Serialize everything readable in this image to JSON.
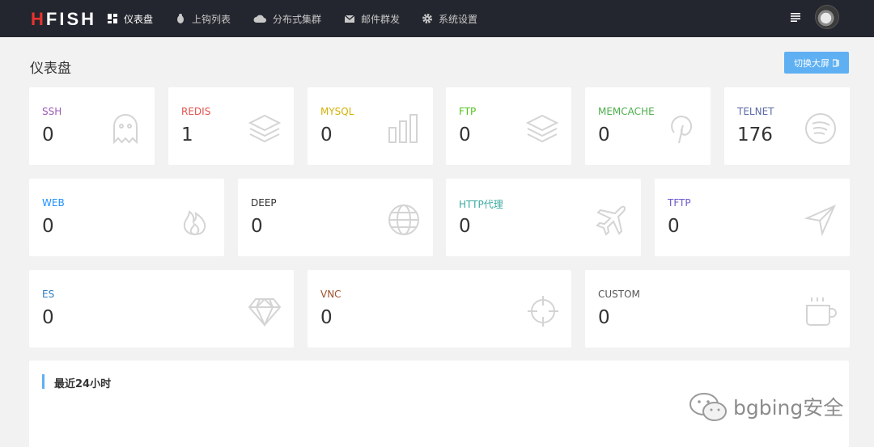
{
  "app": {
    "logo_prefix": "H",
    "logo_rest": "FISH"
  },
  "nav": [
    {
      "label": "仪表盘",
      "icon": "dashboard-icon"
    },
    {
      "label": "上钩列表",
      "icon": "bug-icon"
    },
    {
      "label": "分布式集群",
      "icon": "cloud-icon"
    },
    {
      "label": "邮件群发",
      "icon": "mail-icon"
    },
    {
      "label": "系统设置",
      "icon": "gear-icon"
    }
  ],
  "page": {
    "title": "仪表盘",
    "screen_button": "切换大屏"
  },
  "stats": [
    {
      "label": "SSH",
      "count": "0",
      "color": "#9b59b6",
      "icon": "ghost-icon"
    },
    {
      "label": "REDIS",
      "count": "1",
      "color": "#e0524c",
      "icon": "layers-icon"
    },
    {
      "label": "MYSQL",
      "count": "0",
      "color": "#d4b106",
      "icon": "bar-chart-icon"
    },
    {
      "label": "FTP",
      "count": "0",
      "color": "#52c41a",
      "icon": "layers-icon"
    },
    {
      "label": "MEMCACHE",
      "count": "0",
      "color": "#4cae4c",
      "icon": "pinterest-icon"
    },
    {
      "label": "TELNET",
      "count": "176",
      "color": "#5b6aa8",
      "icon": "spotify-icon"
    },
    {
      "label": "WEB",
      "count": "0",
      "color": "#1e90ff",
      "icon": "fire-icon"
    },
    {
      "label": "DEEP",
      "count": "0",
      "color": "#333333",
      "icon": "globe-icon"
    },
    {
      "label": "HTTP代理",
      "count": "0",
      "color": "#3aa99f",
      "icon": "plane-icon"
    },
    {
      "label": "TFTP",
      "count": "0",
      "color": "#6a5acd",
      "icon": "send-icon"
    },
    {
      "label": "ES",
      "count": "0",
      "color": "#2f7fbf",
      "icon": "diamond-icon"
    },
    {
      "label": "VNC",
      "count": "0",
      "color": "#a0522d",
      "icon": "crosshairs-icon"
    },
    {
      "label": "CUSTOM",
      "count": "0",
      "color": "#555555",
      "icon": "coffee-icon"
    }
  ],
  "panel": {
    "title": "最近24小时"
  },
  "watermark": {
    "text": "bgbing安全"
  }
}
